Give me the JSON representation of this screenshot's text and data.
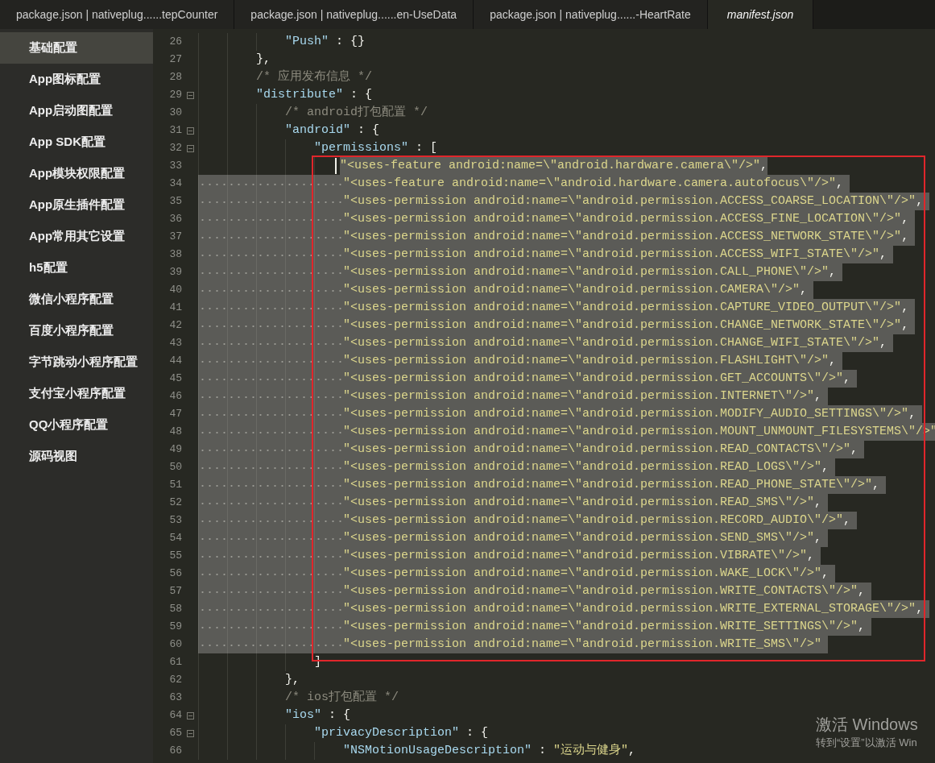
{
  "tabs": [
    {
      "label": "package.json | nativeplug......tepCounter",
      "selected": false
    },
    {
      "label": "package.json | nativeplug......en-UseData",
      "selected": false
    },
    {
      "label": "package.json | nativeplug......-HeartRate",
      "selected": false
    },
    {
      "label": "manifest.json",
      "selected": true
    }
  ],
  "sidebar": {
    "items": [
      {
        "label": "基础配置",
        "selected": true
      },
      {
        "label": "App图标配置",
        "selected": false
      },
      {
        "label": "App启动图配置",
        "selected": false
      },
      {
        "label": "App SDK配置",
        "selected": false
      },
      {
        "label": "App模块权限配置",
        "selected": false
      },
      {
        "label": "App原生插件配置",
        "selected": false
      },
      {
        "label": "App常用其它设置",
        "selected": false
      },
      {
        "label": "h5配置",
        "selected": false
      },
      {
        "label": "微信小程序配置",
        "selected": false
      },
      {
        "label": "百度小程序配置",
        "selected": false
      },
      {
        "label": "字节跳动小程序配置",
        "selected": false
      },
      {
        "label": "支付宝小程序配置",
        "selected": false
      },
      {
        "label": "QQ小程序配置",
        "selected": false
      },
      {
        "label": "源码视图",
        "selected": false
      }
    ]
  },
  "editor": {
    "lines": [
      {
        "number": "26",
        "selected": false,
        "tokens": [
          {
            "kind": "key",
            "text": "            \"Push\""
          },
          {
            "kind": "punct",
            "text": " : {}"
          }
        ]
      },
      {
        "number": "27",
        "selected": false,
        "tokens": [
          {
            "kind": "punct",
            "text": "        },"
          }
        ]
      },
      {
        "number": "28",
        "selected": false,
        "tokens": [
          {
            "kind": "comment",
            "text": "        /* 应用发布信息 */"
          }
        ]
      },
      {
        "number": "29",
        "selected": false,
        "foldable": true,
        "tokens": [
          {
            "kind": "key",
            "text": "        \"distribute\""
          },
          {
            "kind": "punct",
            "text": " : {"
          }
        ]
      },
      {
        "number": "30",
        "selected": false,
        "tokens": [
          {
            "kind": "comment",
            "text": "            /* android打包配置 */"
          }
        ]
      },
      {
        "number": "31",
        "selected": false,
        "foldable": true,
        "tokens": [
          {
            "kind": "key",
            "text": "            \"android\""
          },
          {
            "kind": "punct",
            "text": " : {"
          }
        ]
      },
      {
        "number": "32",
        "selected": false,
        "foldable": true,
        "tokens": [
          {
            "kind": "key",
            "text": "                \"permissions\""
          },
          {
            "kind": "punct",
            "text": " : ["
          }
        ]
      },
      {
        "number": "33",
        "selected": true,
        "cursor": true,
        "tokens": [
          {
            "kind": "str",
            "text": "                    \"<uses-feature android:name=\\\"android.hardware.camera\\\"/>\""
          },
          {
            "kind": "punct",
            "text": ","
          }
        ]
      },
      {
        "number": "34",
        "selected": true,
        "tokens": [
          {
            "kind": "str",
            "text": "                    \"<uses-feature android:name=\\\"android.hardware.camera.autofocus\\\"/>\""
          },
          {
            "kind": "punct",
            "text": ","
          }
        ]
      },
      {
        "number": "35",
        "selected": true,
        "tokens": [
          {
            "kind": "str",
            "text": "                    \"<uses-permission android:name=\\\"android.permission.ACCESS_COARSE_LOCATION\\\"/>\""
          },
          {
            "kind": "punct",
            "text": ","
          }
        ]
      },
      {
        "number": "36",
        "selected": true,
        "tokens": [
          {
            "kind": "str",
            "text": "                    \"<uses-permission android:name=\\\"android.permission.ACCESS_FINE_LOCATION\\\"/>\""
          },
          {
            "kind": "punct",
            "text": ","
          }
        ]
      },
      {
        "number": "37",
        "selected": true,
        "tokens": [
          {
            "kind": "str",
            "text": "                    \"<uses-permission android:name=\\\"android.permission.ACCESS_NETWORK_STATE\\\"/>\""
          },
          {
            "kind": "punct",
            "text": ","
          }
        ]
      },
      {
        "number": "38",
        "selected": true,
        "tokens": [
          {
            "kind": "str",
            "text": "                    \"<uses-permission android:name=\\\"android.permission.ACCESS_WIFI_STATE\\\"/>\""
          },
          {
            "kind": "punct",
            "text": ","
          }
        ]
      },
      {
        "number": "39",
        "selected": true,
        "tokens": [
          {
            "kind": "str",
            "text": "                    \"<uses-permission android:name=\\\"android.permission.CALL_PHONE\\\"/>\""
          },
          {
            "kind": "punct",
            "text": ","
          }
        ]
      },
      {
        "number": "40",
        "selected": true,
        "tokens": [
          {
            "kind": "str",
            "text": "                    \"<uses-permission android:name=\\\"android.permission.CAMERA\\\"/>\""
          },
          {
            "kind": "punct",
            "text": ","
          }
        ]
      },
      {
        "number": "41",
        "selected": true,
        "tokens": [
          {
            "kind": "str",
            "text": "                    \"<uses-permission android:name=\\\"android.permission.CAPTURE_VIDEO_OUTPUT\\\"/>\""
          },
          {
            "kind": "punct",
            "text": ","
          }
        ]
      },
      {
        "number": "42",
        "selected": true,
        "tokens": [
          {
            "kind": "str",
            "text": "                    \"<uses-permission android:name=\\\"android.permission.CHANGE_NETWORK_STATE\\\"/>\""
          },
          {
            "kind": "punct",
            "text": ","
          }
        ]
      },
      {
        "number": "43",
        "selected": true,
        "tokens": [
          {
            "kind": "str",
            "text": "                    \"<uses-permission android:name=\\\"android.permission.CHANGE_WIFI_STATE\\\"/>\""
          },
          {
            "kind": "punct",
            "text": ","
          }
        ]
      },
      {
        "number": "44",
        "selected": true,
        "tokens": [
          {
            "kind": "str",
            "text": "                    \"<uses-permission android:name=\\\"android.permission.FLASHLIGHT\\\"/>\""
          },
          {
            "kind": "punct",
            "text": ","
          }
        ]
      },
      {
        "number": "45",
        "selected": true,
        "tokens": [
          {
            "kind": "str",
            "text": "                    \"<uses-permission android:name=\\\"android.permission.GET_ACCOUNTS\\\"/>\""
          },
          {
            "kind": "punct",
            "text": ","
          }
        ]
      },
      {
        "number": "46",
        "selected": true,
        "tokens": [
          {
            "kind": "str",
            "text": "                    \"<uses-permission android:name=\\\"android.permission.INTERNET\\\"/>\""
          },
          {
            "kind": "punct",
            "text": ","
          }
        ]
      },
      {
        "number": "47",
        "selected": true,
        "tokens": [
          {
            "kind": "str",
            "text": "                    \"<uses-permission android:name=\\\"android.permission.MODIFY_AUDIO_SETTINGS\\\"/>\""
          },
          {
            "kind": "punct",
            "text": ","
          }
        ]
      },
      {
        "number": "48",
        "selected": true,
        "tokens": [
          {
            "kind": "str",
            "text": "                    \"<uses-permission android:name=\\\"android.permission.MOUNT_UNMOUNT_FILESYSTEMS\\\"/>\""
          }
        ]
      },
      {
        "number": "49",
        "selected": true,
        "tokens": [
          {
            "kind": "str",
            "text": "                    \"<uses-permission android:name=\\\"android.permission.READ_CONTACTS\\\"/>\""
          },
          {
            "kind": "punct",
            "text": ","
          }
        ]
      },
      {
        "number": "50",
        "selected": true,
        "tokens": [
          {
            "kind": "str",
            "text": "                    \"<uses-permission android:name=\\\"android.permission.READ_LOGS\\\"/>\""
          },
          {
            "kind": "punct",
            "text": ","
          }
        ]
      },
      {
        "number": "51",
        "selected": true,
        "tokens": [
          {
            "kind": "str",
            "text": "                    \"<uses-permission android:name=\\\"android.permission.READ_PHONE_STATE\\\"/>\""
          },
          {
            "kind": "punct",
            "text": ","
          }
        ]
      },
      {
        "number": "52",
        "selected": true,
        "tokens": [
          {
            "kind": "str",
            "text": "                    \"<uses-permission android:name=\\\"android.permission.READ_SMS\\\"/>\""
          },
          {
            "kind": "punct",
            "text": ","
          }
        ]
      },
      {
        "number": "53",
        "selected": true,
        "tokens": [
          {
            "kind": "str",
            "text": "                    \"<uses-permission android:name=\\\"android.permission.RECORD_AUDIO\\\"/>\""
          },
          {
            "kind": "punct",
            "text": ","
          }
        ]
      },
      {
        "number": "54",
        "selected": true,
        "tokens": [
          {
            "kind": "str",
            "text": "                    \"<uses-permission android:name=\\\"android.permission.SEND_SMS\\\"/>\""
          },
          {
            "kind": "punct",
            "text": ","
          }
        ]
      },
      {
        "number": "55",
        "selected": true,
        "tokens": [
          {
            "kind": "str",
            "text": "                    \"<uses-permission android:name=\\\"android.permission.VIBRATE\\\"/>\""
          },
          {
            "kind": "punct",
            "text": ","
          }
        ]
      },
      {
        "number": "56",
        "selected": true,
        "tokens": [
          {
            "kind": "str",
            "text": "                    \"<uses-permission android:name=\\\"android.permission.WAKE_LOCK\\\"/>\""
          },
          {
            "kind": "punct",
            "text": ","
          }
        ]
      },
      {
        "number": "57",
        "selected": true,
        "tokens": [
          {
            "kind": "str",
            "text": "                    \"<uses-permission android:name=\\\"android.permission.WRITE_CONTACTS\\\"/>\""
          },
          {
            "kind": "punct",
            "text": ","
          }
        ]
      },
      {
        "number": "58",
        "selected": true,
        "tokens": [
          {
            "kind": "str",
            "text": "                    \"<uses-permission android:name=\\\"android.permission.WRITE_EXTERNAL_STORAGE\\\"/>\""
          },
          {
            "kind": "punct",
            "text": ","
          }
        ]
      },
      {
        "number": "59",
        "selected": true,
        "tokens": [
          {
            "kind": "str",
            "text": "                    \"<uses-permission android:name=\\\"android.permission.WRITE_SETTINGS\\\"/>\""
          },
          {
            "kind": "punct",
            "text": ","
          }
        ]
      },
      {
        "number": "60",
        "selected": true,
        "tokens": [
          {
            "kind": "str",
            "text": "                    \"<uses-permission android:name=\\\"android.permission.WRITE_SMS\\\"/>\""
          }
        ]
      },
      {
        "number": "61",
        "selected": false,
        "tokens": [
          {
            "kind": "punct",
            "text": "                ]"
          }
        ]
      },
      {
        "number": "62",
        "selected": false,
        "tokens": [
          {
            "kind": "punct",
            "text": "            },"
          }
        ]
      },
      {
        "number": "63",
        "selected": false,
        "tokens": [
          {
            "kind": "comment",
            "text": "            /* ios打包配置 */"
          }
        ]
      },
      {
        "number": "64",
        "selected": false,
        "foldable": true,
        "tokens": [
          {
            "kind": "key",
            "text": "            \"ios\""
          },
          {
            "kind": "punct",
            "text": " : {"
          }
        ]
      },
      {
        "number": "65",
        "selected": false,
        "foldable": true,
        "tokens": [
          {
            "kind": "key",
            "text": "                \"privacyDescription\""
          },
          {
            "kind": "punct",
            "text": " : {"
          }
        ]
      },
      {
        "number": "66",
        "selected": false,
        "tokens": [
          {
            "kind": "key",
            "text": "                    \"NSMotionUsageDescription\""
          },
          {
            "kind": "punct",
            "text": " : "
          },
          {
            "kind": "str",
            "text": "\"运动与健身\""
          },
          {
            "kind": "punct",
            "text": ","
          }
        ]
      }
    ]
  },
  "activation_notice": {
    "title": "激活 Windows",
    "hint": "转到“设置”以激活 Win"
  }
}
